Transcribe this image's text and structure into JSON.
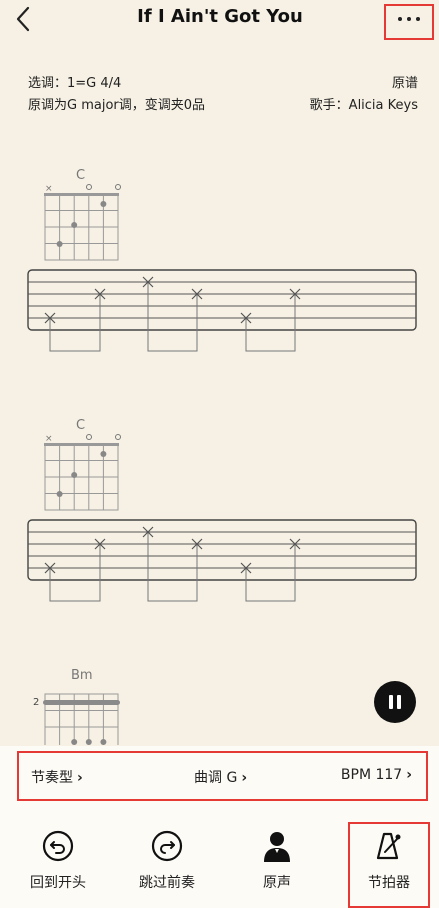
{
  "header": {
    "title": "If I Ain't Got You"
  },
  "info": {
    "key_selection": "选调：1=G 4/4",
    "original_key": "原调为G major调，变调夹0品",
    "source": "原谱",
    "singer": "歌手：Alicia Keys"
  },
  "score": {
    "chords": [
      {
        "name": "C"
      },
      {
        "name": "C"
      },
      {
        "name": "Bm",
        "fret": "2"
      }
    ]
  },
  "options": {
    "rhythm": "节奏型",
    "key": "曲调 G",
    "bpm": "BPM 117"
  },
  "toolbar": {
    "restart": "回到开头",
    "skip_intro": "跳过前奏",
    "original_audio": "原声",
    "metronome": "节拍器"
  },
  "colors": {
    "highlight": "#e53935",
    "background": "#f6f1e4"
  }
}
